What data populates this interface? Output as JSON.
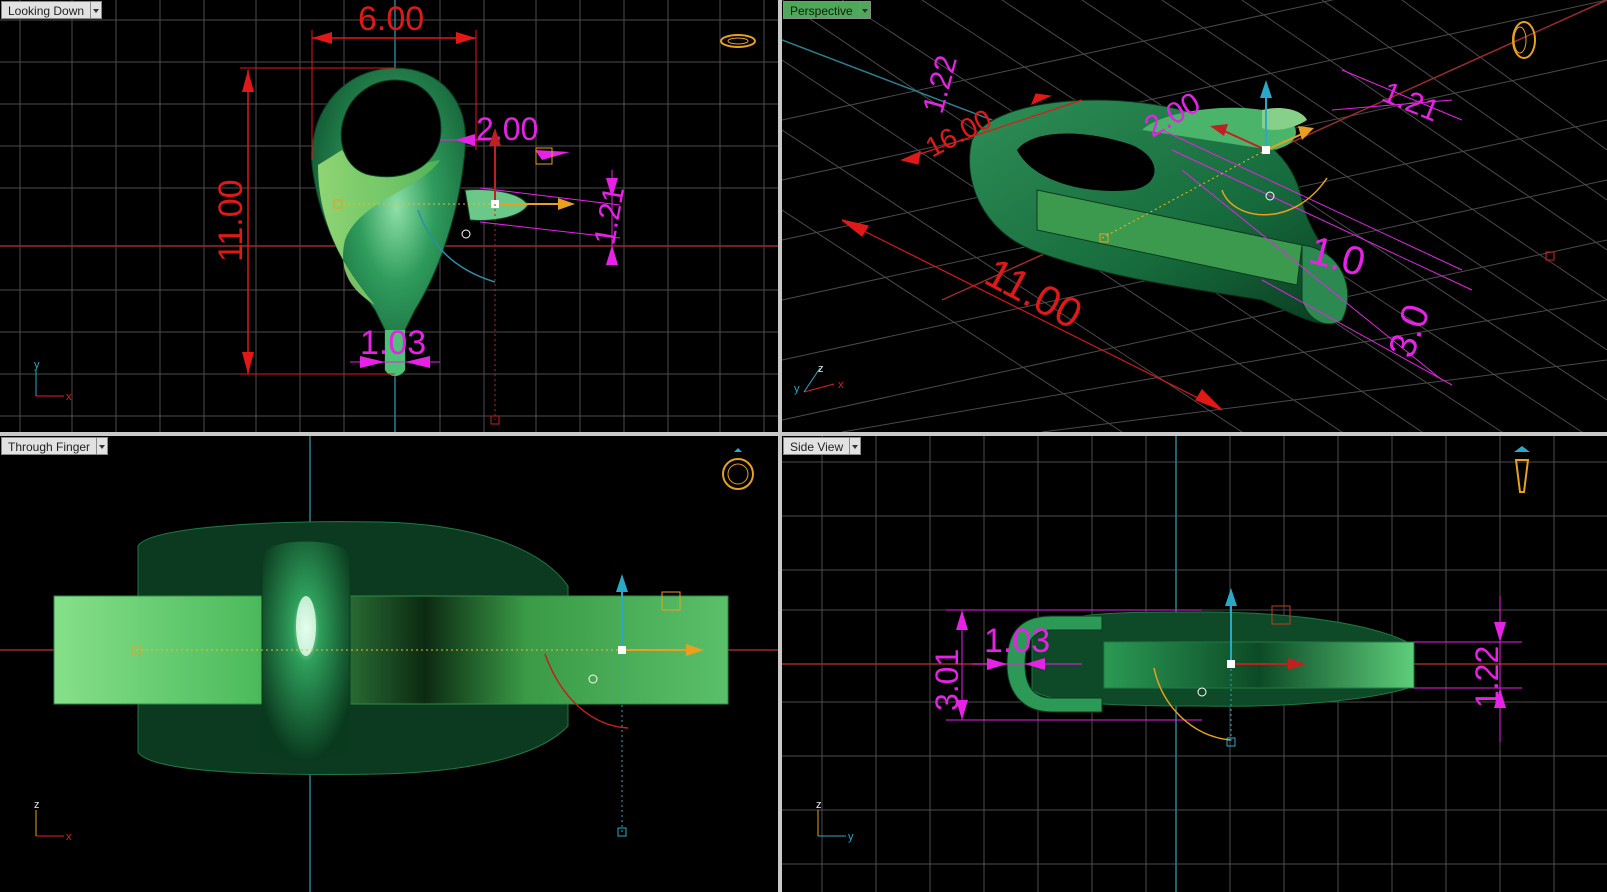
{
  "viewports": {
    "top": {
      "label": "Looking Down"
    },
    "perspective": {
      "label": "Perspective"
    },
    "front": {
      "label": "Through Finger"
    },
    "side": {
      "label": "Side View"
    }
  },
  "top_dims": {
    "width": "6.00",
    "height": "11.00",
    "wall": "2.00",
    "thick": "1.21",
    "tip": "1.03"
  },
  "persp_dims": {
    "d1": "1.22",
    "d2": "16.00",
    "d3": "2.00",
    "d4": "1.21",
    "d5": "11.00",
    "d6": "1.0",
    "d7": "3.0"
  },
  "side_dims": {
    "h": "3.01",
    "w": "1.03",
    "t": "1.22"
  },
  "axes": {
    "top": {
      "a": "x",
      "b": "y"
    },
    "persp": {
      "a": "x",
      "b": "z",
      "c": "y"
    },
    "front": {
      "a": "x",
      "b": "z"
    },
    "side": {
      "a": "y",
      "b": "z"
    }
  },
  "colors": {
    "grid": "#5a5a5a",
    "model": "#1f8a4a",
    "dim": "#e622e6",
    "red": "#e01818",
    "gumball_x": "#e02020",
    "gumball_y": "#2aa8c8",
    "gumball_z": "#f0a020"
  }
}
